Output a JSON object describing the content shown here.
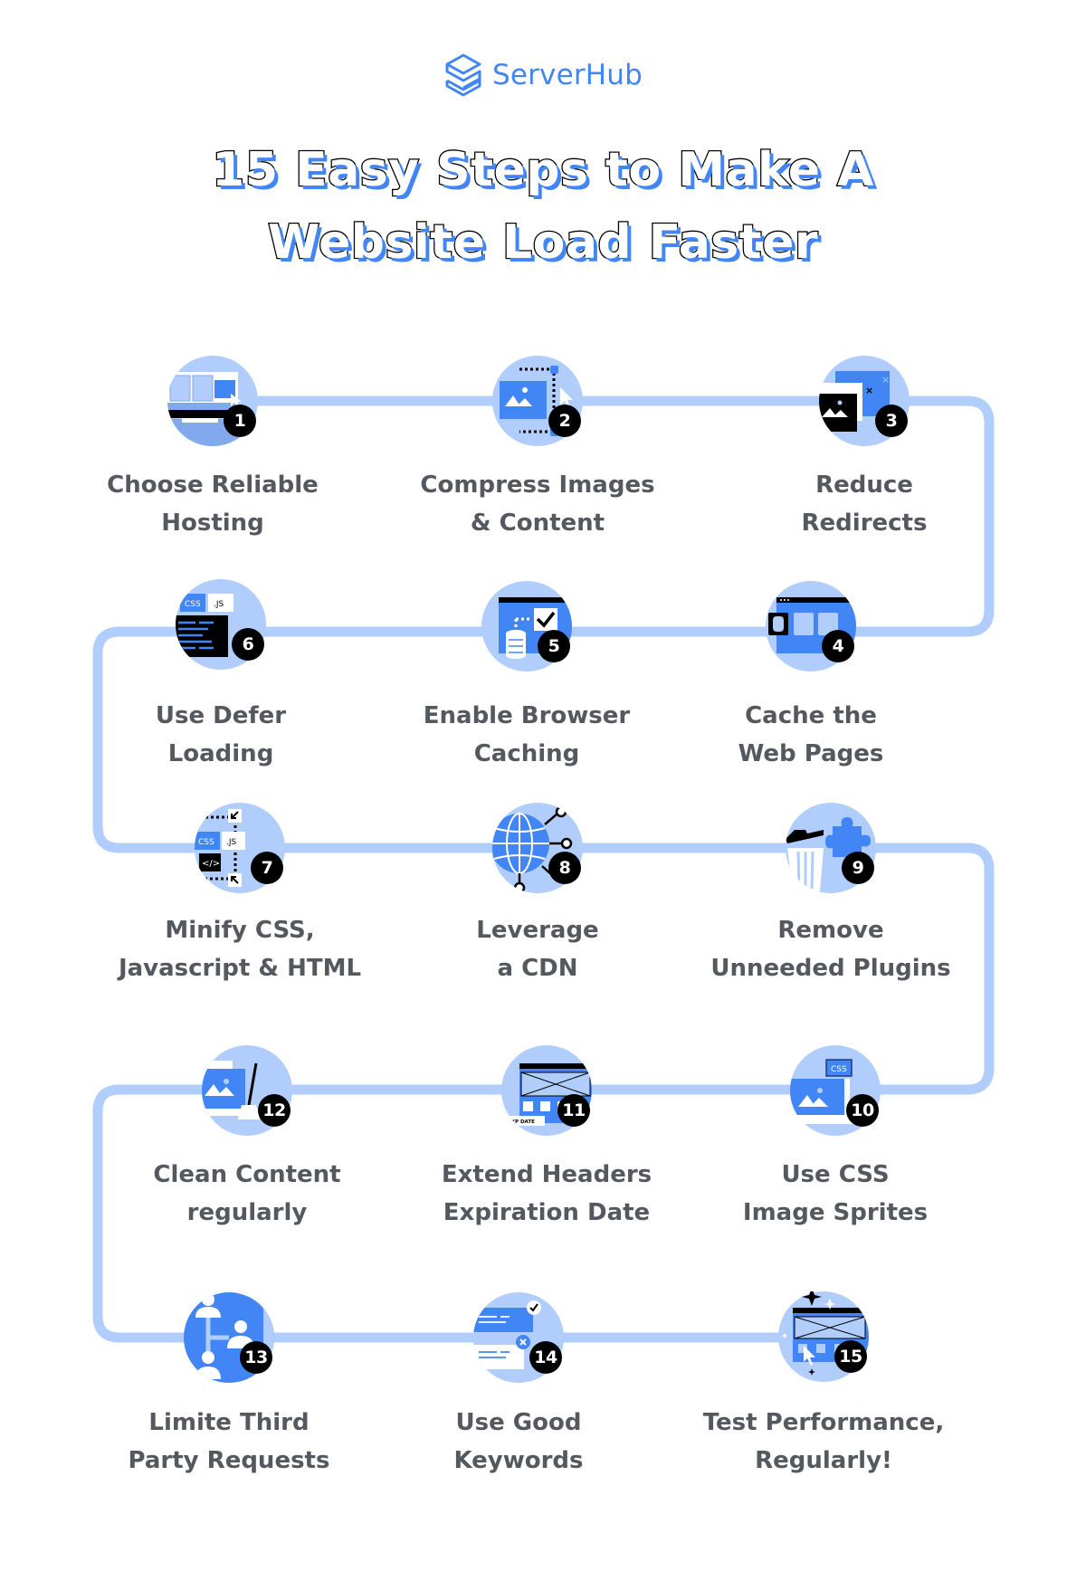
{
  "brand": {
    "name": "ServerHub",
    "logo_icon": "stacked-cube-s-icon",
    "color": "#4285f4"
  },
  "title": {
    "line1": "15 Easy Steps to Make A",
    "line2": "Website Load Faster"
  },
  "colors": {
    "path": "#b1cdfb",
    "circle": "#b1cdfb",
    "accent": "#4285f4",
    "badge": "#000000",
    "label_text": "#54585f",
    "title_shadow": "#4285f4"
  },
  "steps": [
    {
      "number": "1",
      "line1": "Choose Reliable",
      "line2": "Hosting",
      "icon": "monitor-hosting-icon"
    },
    {
      "number": "2",
      "line1": "Compress Images",
      "line2": "& Content",
      "icon": "image-resize-icon"
    },
    {
      "number": "3",
      "line1": "Reduce",
      "line2": "Redirects",
      "icon": "window-redirect-icon"
    },
    {
      "number": "4",
      "line1": "Cache the",
      "line2": "Web Pages",
      "icon": "browser-cache-icon"
    },
    {
      "number": "5",
      "line1": "Enable Browser",
      "line2": "Caching",
      "icon": "browser-database-check-icon"
    },
    {
      "number": "6",
      "line1": "Use Defer",
      "line2": "Loading",
      "icon": "css-js-code-icon"
    },
    {
      "number": "7",
      "line1": "Minify CSS,",
      "line2": "Javascript & HTML",
      "icon": "minify-code-icon"
    },
    {
      "number": "8",
      "line1": "Leverage",
      "line2": "a CDN",
      "icon": "globe-network-icon"
    },
    {
      "number": "9",
      "line1": "Remove",
      "line2": "Unneeded Plugins",
      "icon": "trash-plugin-icon"
    },
    {
      "number": "10",
      "line1": "Use CSS",
      "line2": "Image Sprites",
      "icon": "css-image-sprite-icon"
    },
    {
      "number": "11",
      "line1": "Extend Headers",
      "line2": "Expiration Date",
      "icon": "expiration-date-icon",
      "icon_text": "EXP DATE"
    },
    {
      "number": "12",
      "line1": "Clean Content",
      "line2": "regularly",
      "icon": "broom-image-icon"
    },
    {
      "number": "13",
      "line1": "Limite Third",
      "line2": "Party Requests",
      "icon": "third-party-users-icon"
    },
    {
      "number": "14",
      "line1": "Use Good",
      "line2": "Keywords",
      "icon": "keyword-check-icon"
    },
    {
      "number": "15",
      "line1": "Test Performance,",
      "line2": "Regularly!",
      "icon": "performance-test-icon"
    }
  ],
  "icon_texts": {
    "css": "CSS",
    "js": ".JS",
    "code": "</>",
    "exp_date": "EXP DATE"
  }
}
